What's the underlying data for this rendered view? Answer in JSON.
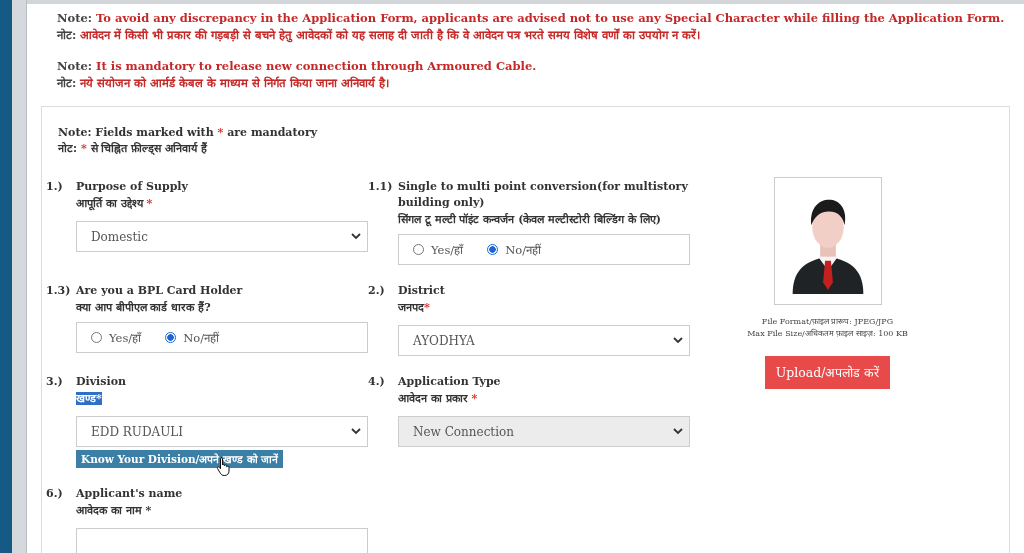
{
  "notes": [
    {
      "lines": [
        {
          "label": "Note:",
          "text": "To avoid any discrepancy in the Application Form, applicants are advised not to use any Special Character while filling the Application Form."
        },
        {
          "label": "नोट:",
          "text": "आवेदन में किसी भी प्रकार की गड़बड़ी से बचने हेतु आवेदकों को यह सलाह दी जाती है कि वे आवेदन पत्र भरते समय विशेष वर्णों का उपयोग न करें।"
        }
      ]
    },
    {
      "lines": [
        {
          "label": "Note:",
          "text": "It is mandatory to release new connection through Armoured Cable."
        },
        {
          "label": "नोट:",
          "text": "नये संयोजन को आर्मर्ड केबल के माध्यम से निर्गत किया जाना अनिवार्य है।"
        }
      ]
    }
  ],
  "form": {
    "mandatory_note": [
      {
        "before": "Note: Fields marked with",
        "mark": "*",
        "after": "are mandatory"
      },
      {
        "before": "नोट:",
        "mark": "*",
        "after": "से चिह्नित फ़ील्ड्स अनिवार्य हैं"
      }
    ],
    "rows": [
      {
        "fields": [
          {
            "number": "1.)",
            "label": "Purpose of Supply",
            "label_hi": "आपूर्ति का उद्देश्य",
            "mark": " *",
            "kind": "select",
            "value": "Domestic",
            "disabled": false
          },
          {
            "number": "1.1)",
            "label": "Single to multi point conversion(for multistory building only)",
            "label_hi": "सिंगल टू मल्टी पॉइंट कन्वर्जन (केवल मल्टीस्टोरी बिल्डिंग के लिए)",
            "kind": "radio",
            "options": [
              {
                "label": "Yes/हाँ",
                "selected": false
              },
              {
                "label": "No/नहीं",
                "selected": true
              }
            ]
          }
        ]
      },
      {
        "fields": [
          {
            "number": "1.3)",
            "label": "Are you a BPL Card Holder",
            "label_hi": "क्या आप बीपीएल कार्ड धारक हैं?",
            "kind": "radio",
            "options": [
              {
                "label": "Yes/हाँ",
                "selected": false
              },
              {
                "label": "No/नहीं",
                "selected": true
              }
            ]
          },
          {
            "number": "2.)",
            "label": "District",
            "label_hi": "जनपद",
            "mark": "*",
            "kind": "select",
            "value": "AYODHYA",
            "disabled": false
          }
        ]
      },
      {
        "fields": [
          {
            "number": "3.)",
            "label": "Division",
            "label_hi": "खण्ड*",
            "highlighted": true,
            "kind": "select",
            "value": "EDD RUDAULI",
            "disabled": false,
            "button": "Know Your Division/अपने खण्ड को जानें"
          },
          {
            "number": "4.)",
            "label": "Application Type",
            "label_hi": "आवेदन का प्रकार",
            "mark": " *",
            "kind": "select",
            "value": "New Connection",
            "disabled": true
          }
        ]
      },
      {
        "fields": [
          {
            "number": "6.)",
            "label": "Applicant's name",
            "label_hi": "आवेदक का नाम *",
            "kind": "input"
          }
        ]
      }
    ],
    "photo": {
      "format": "File Format/फ़ाइल प्रारूप: JPEG/JPG",
      "size": "Max File Size/अधिकतम फ़ाइल साइज़: 100 KB",
      "upload_button": "Upload/अपलोड करें"
    }
  }
}
